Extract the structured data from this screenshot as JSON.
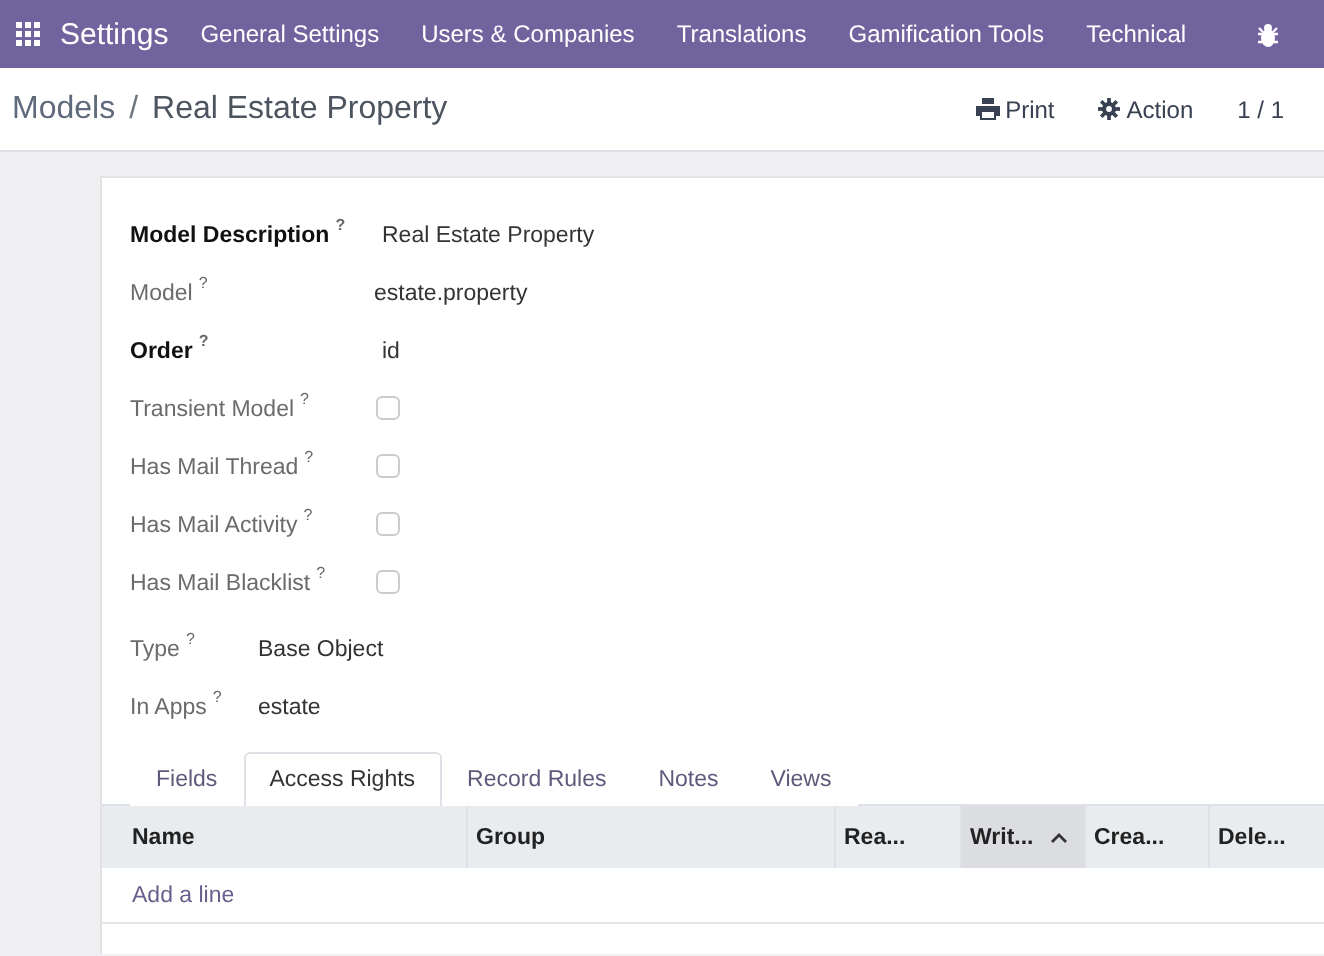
{
  "navbar": {
    "app": "Settings",
    "menus": [
      "General Settings",
      "Users & Companies",
      "Translations",
      "Gamification Tools",
      "Technical"
    ]
  },
  "control_panel": {
    "breadcrumb": [
      {
        "label": "Models",
        "link": true
      },
      {
        "label": "Real Estate Property",
        "link": false
      }
    ],
    "separator": "/",
    "print": "Print",
    "action": "Action",
    "pager": "1 / 1"
  },
  "form": {
    "groups": [
      {
        "fields": [
          {
            "label": "Model Description",
            "help": "?",
            "required": true,
            "kind": "text",
            "value": "Real Estate Property"
          },
          {
            "label": "Model",
            "help": "?",
            "required": false,
            "kind": "text",
            "value": "estate.property"
          },
          {
            "label": "Order",
            "help": "?",
            "required": true,
            "kind": "text",
            "value": "id"
          },
          {
            "label": "Transient Model",
            "help": "?",
            "required": false,
            "kind": "checkbox",
            "checked": false
          },
          {
            "label": "Has Mail Thread",
            "help": "?",
            "required": false,
            "kind": "checkbox",
            "checked": false
          },
          {
            "label": "Has Mail Activity",
            "help": "?",
            "required": false,
            "kind": "checkbox",
            "checked": false
          },
          {
            "label": "Has Mail Blacklist",
            "help": "?",
            "required": false,
            "kind": "checkbox",
            "checked": false
          }
        ]
      },
      {
        "fields": [
          {
            "label": "Type",
            "help": "?",
            "required": false,
            "kind": "text",
            "value": "Base Object"
          },
          {
            "label": "In Apps",
            "help": "?",
            "required": false,
            "kind": "text",
            "value": "estate"
          }
        ]
      }
    ]
  },
  "tabs": [
    {
      "label": "Fields",
      "selected": false
    },
    {
      "label": "Access Rights",
      "selected": true
    },
    {
      "label": "Record Rules",
      "selected": false
    },
    {
      "label": "Notes",
      "selected": false
    },
    {
      "label": "Views",
      "selected": false
    }
  ],
  "table": {
    "columns": [
      {
        "label": "Name",
        "sorted": false
      },
      {
        "label": "Group",
        "sorted": false
      },
      {
        "label": "Rea...",
        "sorted": false
      },
      {
        "label": "Writ...",
        "sorted": true
      },
      {
        "label": "Crea...",
        "sorted": false
      },
      {
        "label": "Dele...",
        "sorted": false
      }
    ],
    "add_line": "Add a line"
  }
}
